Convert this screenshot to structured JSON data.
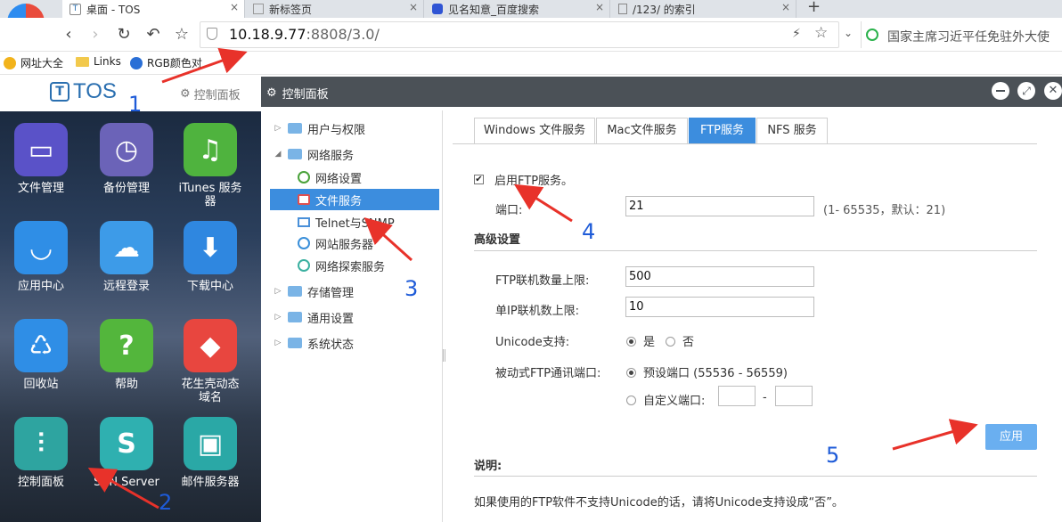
{
  "browser": {
    "tabs": [
      {
        "title": "桌面 - TOS",
        "favicon": "T"
      },
      {
        "title": "新标签页",
        "favicon": ""
      },
      {
        "title": "见名知意_百度搜索",
        "favicon": ""
      },
      {
        "title": "/123/ 的索引",
        "favicon": ""
      }
    ],
    "new_tab_symbol": "+",
    "close_symbol": "×",
    "url_host": "10.18.9.77",
    "url_rest": ":8808/3.0/",
    "search_text": "国家主席习近平任免驻外大使",
    "bookmarks": [
      "网址大全",
      "Links",
      "RGB颜色对"
    ]
  },
  "desktop": {
    "logo": "TOS",
    "control_panel_link": "控制面板",
    "apps": [
      {
        "label": "文件管理",
        "color": "#5a52c8"
      },
      {
        "label": "备份管理",
        "color": "#6b63b8"
      },
      {
        "label": "iTunes 服务器",
        "color": "#4fb33e"
      },
      {
        "label": "应用中心",
        "color": "#2f8ee6"
      },
      {
        "label": "远程登录",
        "color": "#3d9be8"
      },
      {
        "label": "下载中心",
        "color": "#2f87e0"
      },
      {
        "label": "回收站",
        "color": "#2f8ee6"
      },
      {
        "label": "帮助",
        "color": "#53b63c"
      },
      {
        "label": "花生壳动态域名",
        "color": "#e8463f"
      },
      {
        "label": "控制面板",
        "color": "#2ea4a0"
      },
      {
        "label": "SVN Server",
        "color": "#2fb0b0"
      },
      {
        "label": "邮件服务器",
        "color": "#2aa8a6"
      }
    ]
  },
  "window": {
    "title": "控制面板",
    "tree": {
      "users": "用户与权限",
      "network": "网络服务",
      "network_children": [
        "网络设置",
        "文件服务",
        "Telnet与SNMP",
        "网站服务器",
        "网络探索服务"
      ],
      "storage": "存储管理",
      "general": "通用设置",
      "status": "系统状态"
    },
    "service_tabs": [
      "Windows 文件服务",
      "Mac文件服务",
      "FTP服务",
      "NFS 服务"
    ],
    "ftp": {
      "enable_label": "启用FTP服务。",
      "port_label": "端口:",
      "port_value": "21",
      "port_hint": "(1- 65535，默认：21)",
      "advanced_title": "高级设置",
      "max_conn_label": "FTP联机数量上限:",
      "max_conn_value": "500",
      "max_ip_label": "单IP联机数上限:",
      "max_ip_value": "10",
      "unicode_label": "Unicode支持:",
      "unicode_yes": "是",
      "unicode_no": "否",
      "passive_label": "被动式FTP通讯端口:",
      "passive_default": "预设端口 (55536 - 56559)",
      "passive_custom": "自定义端口:",
      "range_dash": "-",
      "apply": "应用",
      "note_title": "说明:",
      "note_text": "如果使用的FTP软件不支持Unicode的话，请将Unicode支持设成“否”。"
    }
  },
  "annotations": [
    "1",
    "2",
    "3",
    "4",
    "5"
  ],
  "colors": {
    "accent": "#3c8dde",
    "arrow": "#e8322a",
    "annotation": "#1e5bd8"
  }
}
